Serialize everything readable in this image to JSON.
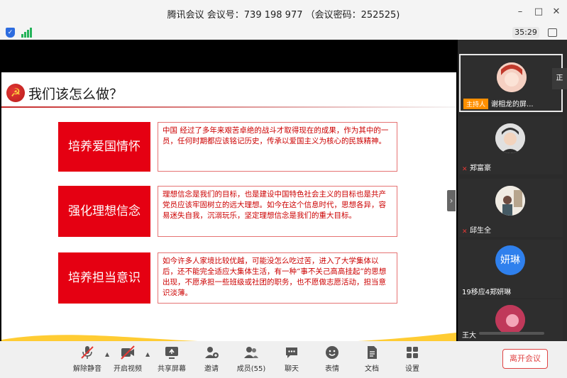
{
  "window": {
    "title": "腾讯会议 会议号：739 198 977 （会议密码：252525)",
    "min_glyph": "–",
    "max_glyph": "□",
    "close_glyph": "✕"
  },
  "status": {
    "timer": "35:29",
    "shield_glyph": "✓"
  },
  "slide": {
    "title": "我们该怎么做？",
    "emblem_glyph": "☭",
    "items": [
      {
        "heading": "培养爱国情怀",
        "body": "中国 经过了多年来艰苦卓绝的战斗才取得现在的成果，作为其中的一员，任何时期都应该铭记历史，传承以爱国主义为核心的民族精神。"
      },
      {
        "heading": "强化理想信念",
        "body": "理想信念是我们的目标，也是建设中国特色社会主义的目标也是共产党员应该牢固树立的远大理想。如今在这个信息时代，思想各异，容易迷失自我，沉溺玩乐，坚定理想信念是我们的重大目标。"
      },
      {
        "heading": "培养担当意识",
        "body": "如今许多人家境比较优越，可能没怎么吃过苦，进入了大学集体以后，还不能完全适应大集体生活，有一种“事不关己高高挂起”的思想出现，不愿承担一些班级或社团的职务，也不愿做志愿活动，担当意识淡薄。"
      }
    ],
    "nav_glyph": "›"
  },
  "participants": [
    {
      "label": "谢相龙的屏...",
      "host_badge": "主持人",
      "active": true
    },
    {
      "label": "郑富豪",
      "active": false
    },
    {
      "label": "邱生全",
      "active": false
    },
    {
      "label": "19移应4郑妍琳",
      "avatar_text": "妍琳",
      "active": false
    },
    {
      "label": "王大",
      "active": false
    }
  ],
  "side_tab": "正",
  "toolbar": {
    "unmute": "解除静音",
    "video": "开启视频",
    "share": "共享屏幕",
    "invite": "邀请",
    "members": "成员(55)",
    "chat": "聊天",
    "emoji": "表情",
    "docs": "文档",
    "settings": "设置",
    "leave": "离开会议",
    "caret_glyph": "▲"
  },
  "colors": {
    "accent_red": "#e50012",
    "leave_red": "#e04343",
    "avatar_blue": "#2f80ed"
  }
}
